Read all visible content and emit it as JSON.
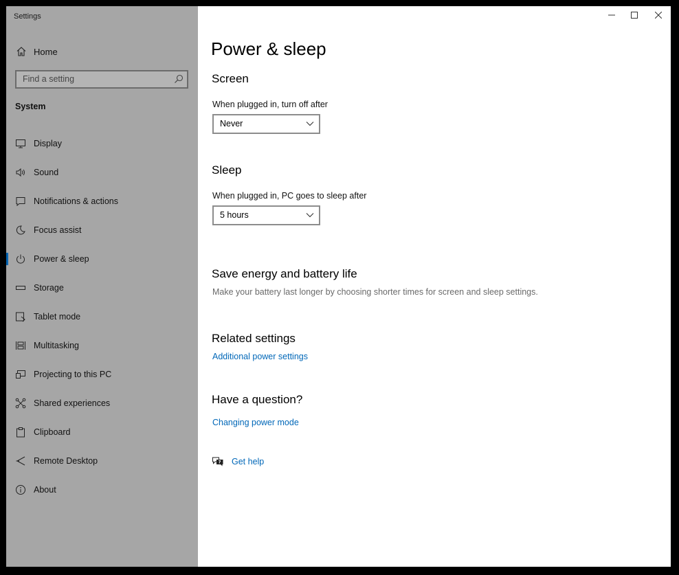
{
  "window": {
    "title": "Settings"
  },
  "sidebar": {
    "home_label": "Home",
    "search_placeholder": "Find a setting",
    "section": "System",
    "items": [
      {
        "label": "Display",
        "icon": "monitor-icon"
      },
      {
        "label": "Sound",
        "icon": "speaker-icon"
      },
      {
        "label": "Notifications & actions",
        "icon": "notification-icon"
      },
      {
        "label": "Focus assist",
        "icon": "moon-icon"
      },
      {
        "label": "Power & sleep",
        "icon": "power-icon",
        "selected": true
      },
      {
        "label": "Storage",
        "icon": "storage-icon"
      },
      {
        "label": "Tablet mode",
        "icon": "tablet-icon"
      },
      {
        "label": "Multitasking",
        "icon": "multitasking-icon"
      },
      {
        "label": "Projecting to this PC",
        "icon": "projecting-icon"
      },
      {
        "label": "Shared experiences",
        "icon": "shared-icon"
      },
      {
        "label": "Clipboard",
        "icon": "clipboard-icon"
      },
      {
        "label": "Remote Desktop",
        "icon": "remote-desktop-icon"
      },
      {
        "label": "About",
        "icon": "info-icon"
      }
    ]
  },
  "main": {
    "title": "Power & sleep",
    "screen": {
      "heading": "Screen",
      "label": "When plugged in, turn off after",
      "value": "Never"
    },
    "sleep": {
      "heading": "Sleep",
      "label": "When plugged in, PC goes to sleep after",
      "value": "5 hours"
    },
    "save_energy": {
      "heading": "Save energy and battery life",
      "description": "Make your battery last longer by choosing shorter times for screen and sleep settings."
    },
    "related": {
      "heading": "Related settings",
      "link": "Additional power settings"
    },
    "question": {
      "heading": "Have a question?",
      "link": "Changing power mode"
    },
    "get_help": "Get help"
  },
  "colors": {
    "sidebar_bg": "#a6a6a6",
    "accent": "#0063b1",
    "link": "#0067b8"
  }
}
